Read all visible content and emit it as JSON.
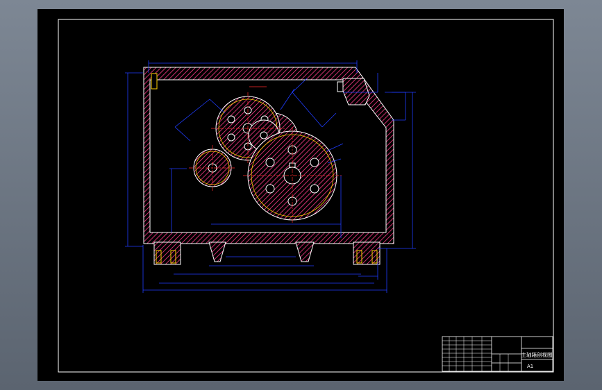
{
  "drawing": {
    "title_block": {
      "drawing_title": "主轴箱剖视图",
      "sheet_size": "A1"
    },
    "colors": {
      "background": "#000000",
      "viewport_bg": "#6b7480",
      "border": "#ffffff",
      "outline": "#ffffff",
      "section_hatch": "#ff3d8a",
      "dimension": "#1f3dff",
      "centerline": "#ff2a2a",
      "hidden_line": "#ffd000",
      "title_block": "#ffffff"
    },
    "icons": [
      "gear-large",
      "gear-medium",
      "gear-small",
      "housing-section"
    ]
  }
}
